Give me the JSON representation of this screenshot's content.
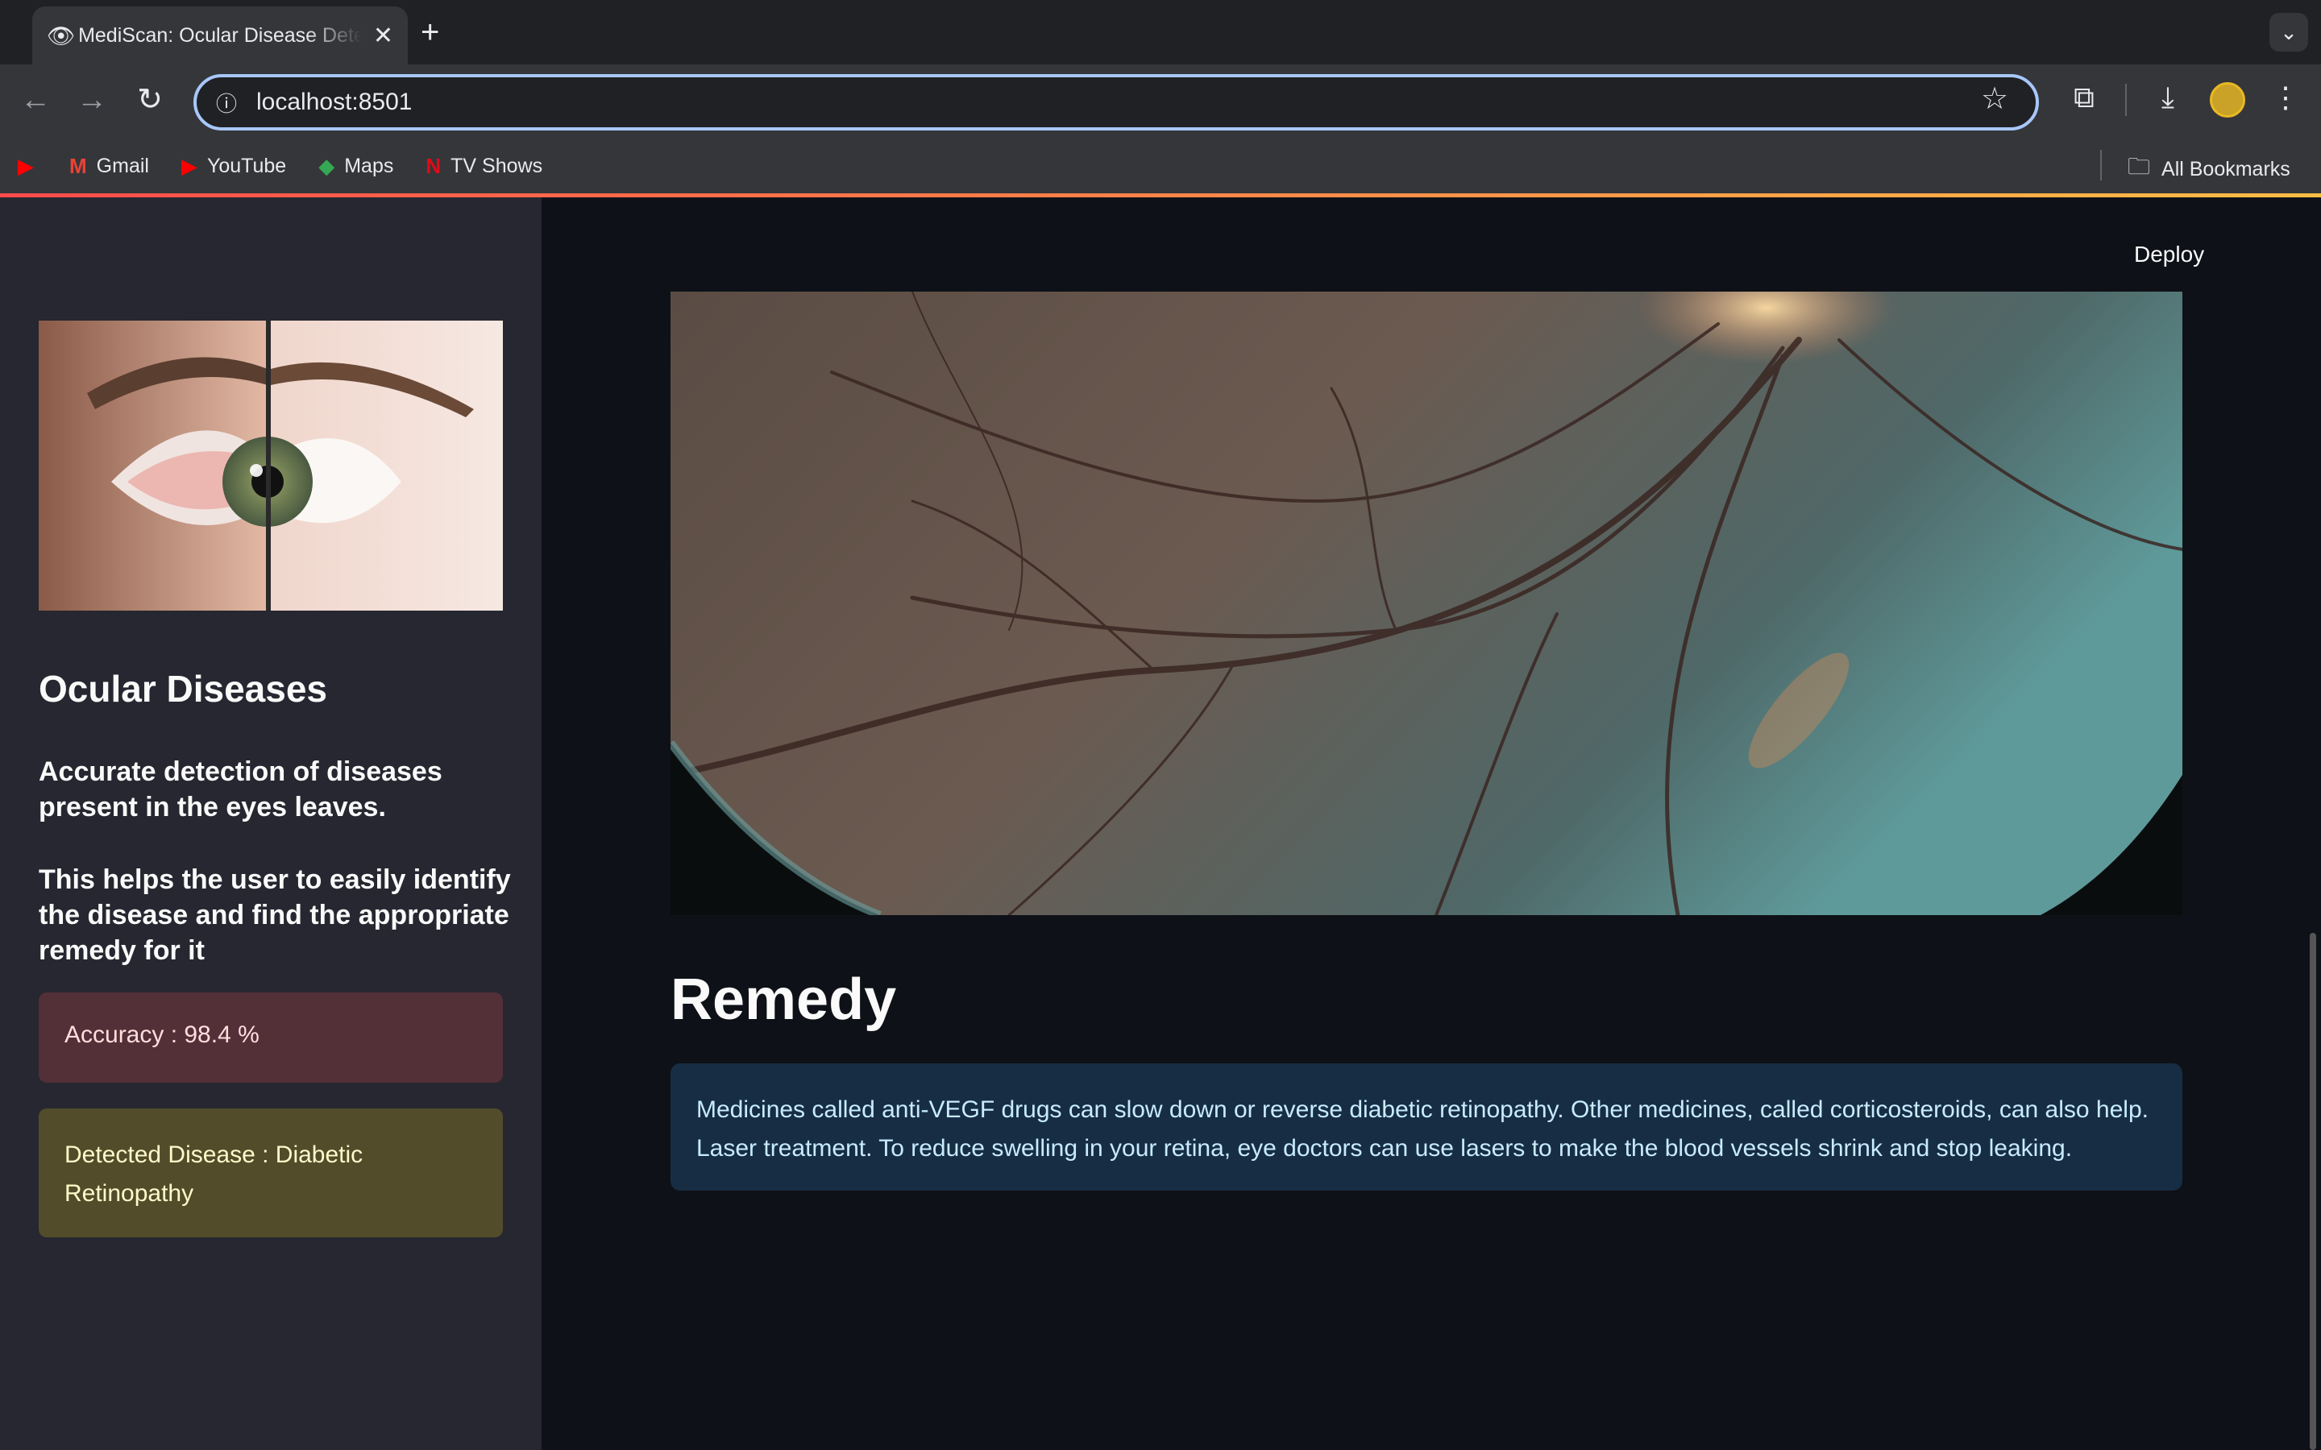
{
  "browser": {
    "tab_title": "MediScan: Ocular Disease Detection",
    "url": "localhost:8501",
    "bookmarks": [
      {
        "label": "",
        "icon": "youtube-icon"
      },
      {
        "label": "Gmail",
        "icon": "gmail-icon"
      },
      {
        "label": "YouTube",
        "icon": "youtube-icon"
      },
      {
        "label": "Maps",
        "icon": "maps-icon"
      },
      {
        "label": "TV Shows",
        "icon": "netflix-icon"
      }
    ],
    "all_bookmarks": "All Bookmarks"
  },
  "sidebar": {
    "title": "Ocular Diseases",
    "desc1": "Accurate detection of diseases present in the eyes leaves.",
    "desc2": "This helps the user to easily identify the disease and find the appropriate remedy for it",
    "accuracy": "Accuracy : 98.4 %",
    "detected": "Detected Disease : Diabetic Retinopathy"
  },
  "main": {
    "deploy": "Deploy",
    "remedy_heading": "Remedy",
    "remedy_text": "Medicines called anti-VEGF drugs can slow down or reverse diabetic retinopathy. Other medicines, called corticosteroids, can also help. Laser treatment. To reduce swelling in your retina, eye doctors can use lasers to make the blood vessels shrink and stop leaking."
  },
  "colors": {
    "accent_stripe_start": "#ff4b4b",
    "accent_stripe_end": "#ffbd45",
    "accuracy_bg": "#532f37",
    "detected_bg": "#534c2a",
    "remedy_bg": "#172d43"
  }
}
